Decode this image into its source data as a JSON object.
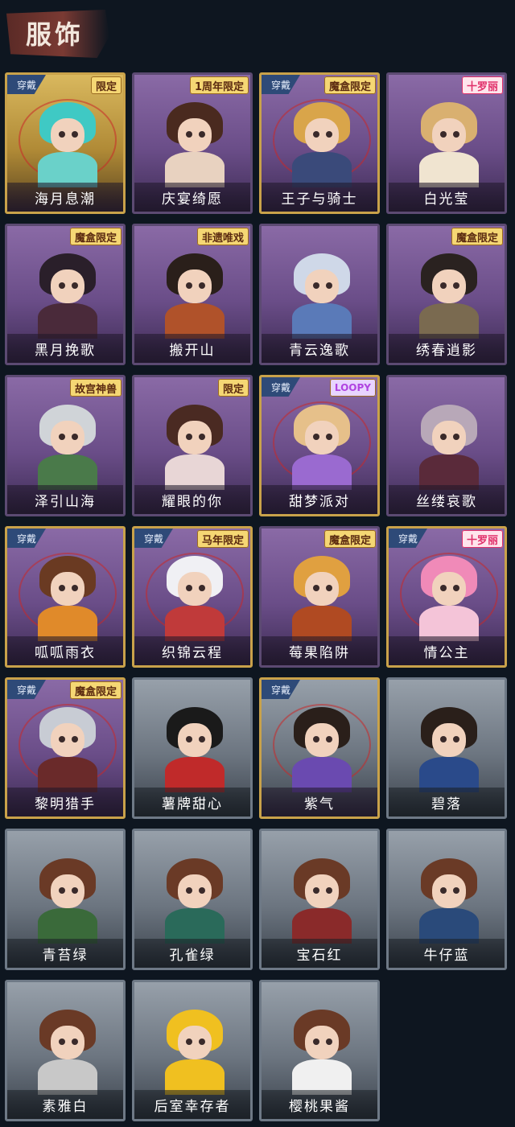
{
  "header": {
    "title": "服饰"
  },
  "wear_label": "穿戴",
  "cards": [
    {
      "name": "海月息潮",
      "style": "gold gold-bg",
      "worn": true,
      "tag": "限定",
      "tag_style": "",
      "hair": "#3fc9c4",
      "cloth": "#6ad1c9"
    },
    {
      "name": "庆宴绮愿",
      "style": "purple",
      "worn": false,
      "tag": "1周年限定",
      "tag_style": "",
      "hair": "#4a2a1f",
      "cloth": "#e8d2c0"
    },
    {
      "name": "王子与骑士",
      "style": "gold purple",
      "worn": true,
      "tag": "魔盒限定",
      "tag_style": "",
      "hair": "#d9a54a",
      "cloth": "#3a4a7a"
    },
    {
      "name": "白光莹",
      "style": "purple",
      "worn": false,
      "tag": "十罗丽",
      "tag_style": "pink",
      "hair": "#d9b070",
      "cloth": "#f0e4d0"
    },
    {
      "name": "黑月挽歌",
      "style": "purple",
      "worn": false,
      "tag": "魔盒限定",
      "tag_style": "",
      "hair": "#2a1f2a",
      "cloth": "#4a2a3a"
    },
    {
      "name": "搬开山",
      "style": "purple",
      "worn": false,
      "tag": "非遗唯戏",
      "tag_style": "",
      "hair": "#2a1f1a",
      "cloth": "#b0522a"
    },
    {
      "name": "青云逸歌",
      "style": "purple",
      "worn": false,
      "tag": "",
      "tag_style": "",
      "hair": "#cfd8e8",
      "cloth": "#5a7ab8"
    },
    {
      "name": "绣春逍影",
      "style": "purple",
      "worn": false,
      "tag": "魔盒限定",
      "tag_style": "",
      "hair": "#2a2220",
      "cloth": "#7a6a50"
    },
    {
      "name": "泽引山海",
      "style": "purple",
      "worn": false,
      "tag": "故宫神兽",
      "tag_style": "",
      "hair": "#d0d4d8",
      "cloth": "#4a7a4a"
    },
    {
      "name": "耀眼的你",
      "style": "purple",
      "worn": false,
      "tag": "限定",
      "tag_style": "",
      "hair": "#4a2a22",
      "cloth": "#e8d6d6"
    },
    {
      "name": "甜梦派对",
      "style": "gold purple",
      "worn": true,
      "tag": "LOOPY",
      "tag_style": "loopy",
      "hair": "#e6c08a",
      "cloth": "#9a6ad0"
    },
    {
      "name": "丝缕哀歌",
      "style": "purple",
      "worn": false,
      "tag": "",
      "tag_style": "",
      "hair": "#b8a8b8",
      "cloth": "#5a2a3a"
    },
    {
      "name": "呱呱雨衣",
      "style": "gold purple",
      "worn": true,
      "tag": "",
      "tag_style": "",
      "hair": "#6a3a22",
      "cloth": "#e08a2a"
    },
    {
      "name": "织锦云程",
      "style": "gold purple",
      "worn": true,
      "tag": "马年限定",
      "tag_style": "",
      "hair": "#f0f0f4",
      "cloth": "#c03a3a"
    },
    {
      "name": "莓果陷阱",
      "style": "purple",
      "worn": false,
      "tag": "魔盒限定",
      "tag_style": "",
      "hair": "#e0a040",
      "cloth": "#b04a22"
    },
    {
      "name": "情公主",
      "style": "gold purple",
      "worn": true,
      "tag": "十罗丽",
      "tag_style": "pink",
      "hair": "#f08ab8",
      "cloth": "#f4c4d8"
    },
    {
      "name": "黎明猎手",
      "style": "gold purple",
      "worn": true,
      "tag": "魔盒限定",
      "tag_style": "",
      "hair": "#c8ccd4",
      "cloth": "#6a2a2a"
    },
    {
      "name": "薯牌甜心",
      "style": "grey",
      "worn": false,
      "tag": "",
      "tag_style": "",
      "hair": "#1a1a1a",
      "cloth": "#c02a2a"
    },
    {
      "name": "紫气",
      "style": "gold grey-bg",
      "worn": true,
      "tag": "",
      "tag_style": "",
      "hair": "#2a1f1a",
      "cloth": "#6a4ab0"
    },
    {
      "name": "碧落",
      "style": "grey",
      "worn": false,
      "tag": "",
      "tag_style": "",
      "hair": "#2a1f1a",
      "cloth": "#2a4a8a"
    },
    {
      "name": "青苔绿",
      "style": "grey",
      "worn": false,
      "tag": "",
      "tag_style": "",
      "hair": "#6a3a26",
      "cloth": "#3a6a3a"
    },
    {
      "name": "孔雀绿",
      "style": "grey",
      "worn": false,
      "tag": "",
      "tag_style": "",
      "hair": "#6a3a26",
      "cloth": "#2a6a5a"
    },
    {
      "name": "宝石红",
      "style": "grey",
      "worn": false,
      "tag": "",
      "tag_style": "",
      "hair": "#6a3a26",
      "cloth": "#8a2a2a"
    },
    {
      "name": "牛仔蓝",
      "style": "grey",
      "worn": false,
      "tag": "",
      "tag_style": "",
      "hair": "#6a3a26",
      "cloth": "#2a4a7a"
    },
    {
      "name": "素雅白",
      "style": "grey",
      "worn": false,
      "tag": "",
      "tag_style": "",
      "hair": "#6a3a26",
      "cloth": "#c8c8c8"
    },
    {
      "name": "后室幸存者",
      "style": "grey",
      "worn": false,
      "tag": "",
      "tag_style": "",
      "hair": "#f0c020",
      "cloth": "#f0c020"
    },
    {
      "name": "樱桃果酱",
      "style": "grey",
      "worn": false,
      "tag": "",
      "tag_style": "",
      "hair": "#6a3a26",
      "cloth": "#f0f0f0"
    }
  ]
}
